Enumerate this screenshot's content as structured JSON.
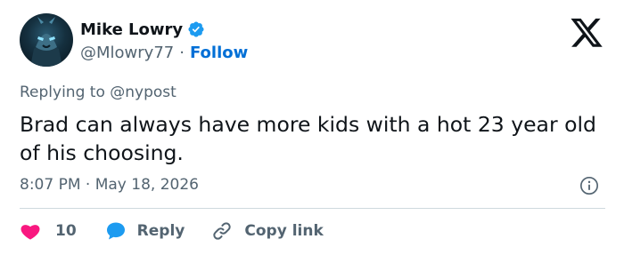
{
  "author": {
    "display_name": "Mike Lowry",
    "handle": "@Mlowry77",
    "separator": "·",
    "follow_label": "Follow",
    "avatar_icon": "masked-warrior-avatar",
    "verified_icon": "verified-badge-icon"
  },
  "reply_context": {
    "prefix": "Replying to",
    "mention": "@nypost"
  },
  "tweet": {
    "text": "Brad can always have more kids with a hot 23 year old of his choosing.",
    "timestamp": "8:07 PM · May 18, 2026"
  },
  "actions": {
    "like_count": "10",
    "reply_label": "Reply",
    "copy_link_label": "Copy link"
  },
  "colors": {
    "accent": "#006fd6",
    "verified": "#1d9bf0",
    "like": "#f91880",
    "muted": "#536471",
    "text": "#0f1419"
  }
}
